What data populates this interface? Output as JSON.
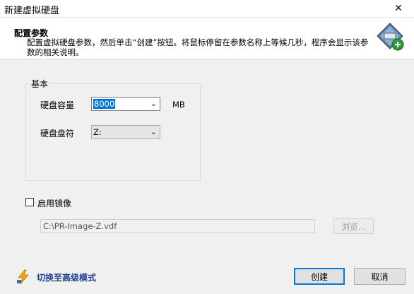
{
  "window": {
    "title": "新建虚拟硬盘",
    "close_glyph": "✕"
  },
  "header": {
    "title": "配置参数",
    "description": "配置虚拟硬盘参数，然后单击“创建”按钮。将鼠标停留在参数名称上等候几秒，程序会显示该参数的相关说明。",
    "icon": "disk-add-icon"
  },
  "basic": {
    "legend": "基本",
    "capacity_label": "硬盘容量",
    "capacity_value": "8000",
    "capacity_unit": "MB",
    "drive_label": "硬盘盘符",
    "drive_value": "Z:"
  },
  "mirror": {
    "checkbox_label": "启用镜像",
    "checked": false,
    "path_value": "C:\\PR-Image-Z.vdf",
    "browse_label": "浏览..."
  },
  "footer": {
    "advanced_label": "切换至高级模式",
    "advanced_icon": "lightning-icon",
    "create_label": "创建",
    "cancel_label": "取消"
  },
  "colors": {
    "selection": "#0078d7",
    "link": "#1f3f8a",
    "accent": "#f2a900"
  }
}
